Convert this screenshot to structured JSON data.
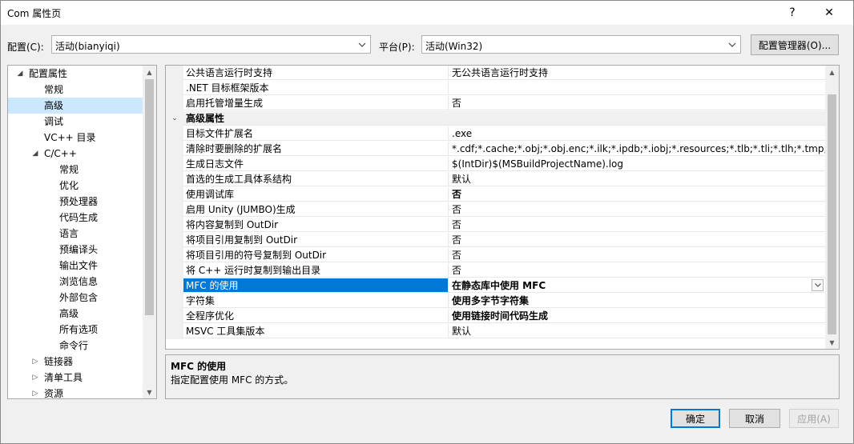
{
  "window": {
    "title": "Com 属性页",
    "help": "?",
    "close": "✕"
  },
  "config": {
    "label": "配置(C):",
    "value": "活动(bianyiqi)"
  },
  "platform": {
    "label": "平台(P):",
    "value": "活动(Win32)"
  },
  "config_manager_label": "配置管理器(O)...",
  "tree": {
    "items": [
      {
        "label": "配置属性",
        "level": 0,
        "expander": "◢"
      },
      {
        "label": "常规",
        "level": 1
      },
      {
        "label": "高级",
        "level": 1,
        "selected": true
      },
      {
        "label": "调试",
        "level": 1
      },
      {
        "label": "VC++ 目录",
        "level": 1
      },
      {
        "label": "C/C++",
        "level": 1,
        "expander": "◢"
      },
      {
        "label": "常规",
        "level": 2
      },
      {
        "label": "优化",
        "level": 2
      },
      {
        "label": "预处理器",
        "level": 2
      },
      {
        "label": "代码生成",
        "level": 2
      },
      {
        "label": "语言",
        "level": 2
      },
      {
        "label": "预编译头",
        "level": 2
      },
      {
        "label": "输出文件",
        "level": 2
      },
      {
        "label": "浏览信息",
        "level": 2
      },
      {
        "label": "外部包含",
        "level": 2
      },
      {
        "label": "高级",
        "level": 2
      },
      {
        "label": "所有选项",
        "level": 2
      },
      {
        "label": "命令行",
        "level": 2
      },
      {
        "label": "链接器",
        "level": 1,
        "expander": "▷"
      },
      {
        "label": "清单工具",
        "level": 1,
        "expander": "▷"
      },
      {
        "label": "资源",
        "level": 1,
        "expander": "▷"
      }
    ]
  },
  "grid": {
    "rows": [
      {
        "name": "公共语言运行时支持",
        "value": "无公共语言运行时支持"
      },
      {
        "name": ".NET 目标框架版本",
        "value": ""
      },
      {
        "name": "启用托管增量生成",
        "value": "否"
      },
      {
        "name": "高级属性",
        "value": "",
        "category": true,
        "expander": "⌄"
      },
      {
        "name": "目标文件扩展名",
        "value": ".exe"
      },
      {
        "name": "清除时要删除的扩展名",
        "value": "*.cdf;*.cache;*.obj;*.obj.enc;*.ilk;*.ipdb;*.iobj;*.resources;*.tlb;*.tli;*.tlh;*.tmp;*.rsp;*.p"
      },
      {
        "name": "生成日志文件",
        "value": "$(IntDir)$(MSBuildProjectName).log"
      },
      {
        "name": "首选的生成工具体系结构",
        "value": "默认"
      },
      {
        "name": "使用调试库",
        "value": "否",
        "bold": true
      },
      {
        "name": "启用 Unity (JUMBO)生成",
        "value": "否"
      },
      {
        "name": "将内容复制到 OutDir",
        "value": "否"
      },
      {
        "name": "将项目引用复制到 OutDir",
        "value": "否"
      },
      {
        "name": "将项目引用的符号复制到 OutDir",
        "value": "否"
      },
      {
        "name": "将 C++ 运行时复制到输出目录",
        "value": "否"
      },
      {
        "name": "MFC 的使用",
        "value": "在静态库中使用 MFC",
        "bold": true,
        "selected": true
      },
      {
        "name": "字符集",
        "value": "使用多字节字符集",
        "bold": true
      },
      {
        "name": "全程序优化",
        "value": "使用链接时间代码生成",
        "bold": true
      },
      {
        "name": "MSVC 工具集版本",
        "value": "默认"
      }
    ]
  },
  "description": {
    "title": "MFC 的使用",
    "text": "指定配置使用 MFC 的方式。"
  },
  "buttons": {
    "ok": "确定",
    "cancel": "取消",
    "apply": "应用(A)"
  }
}
